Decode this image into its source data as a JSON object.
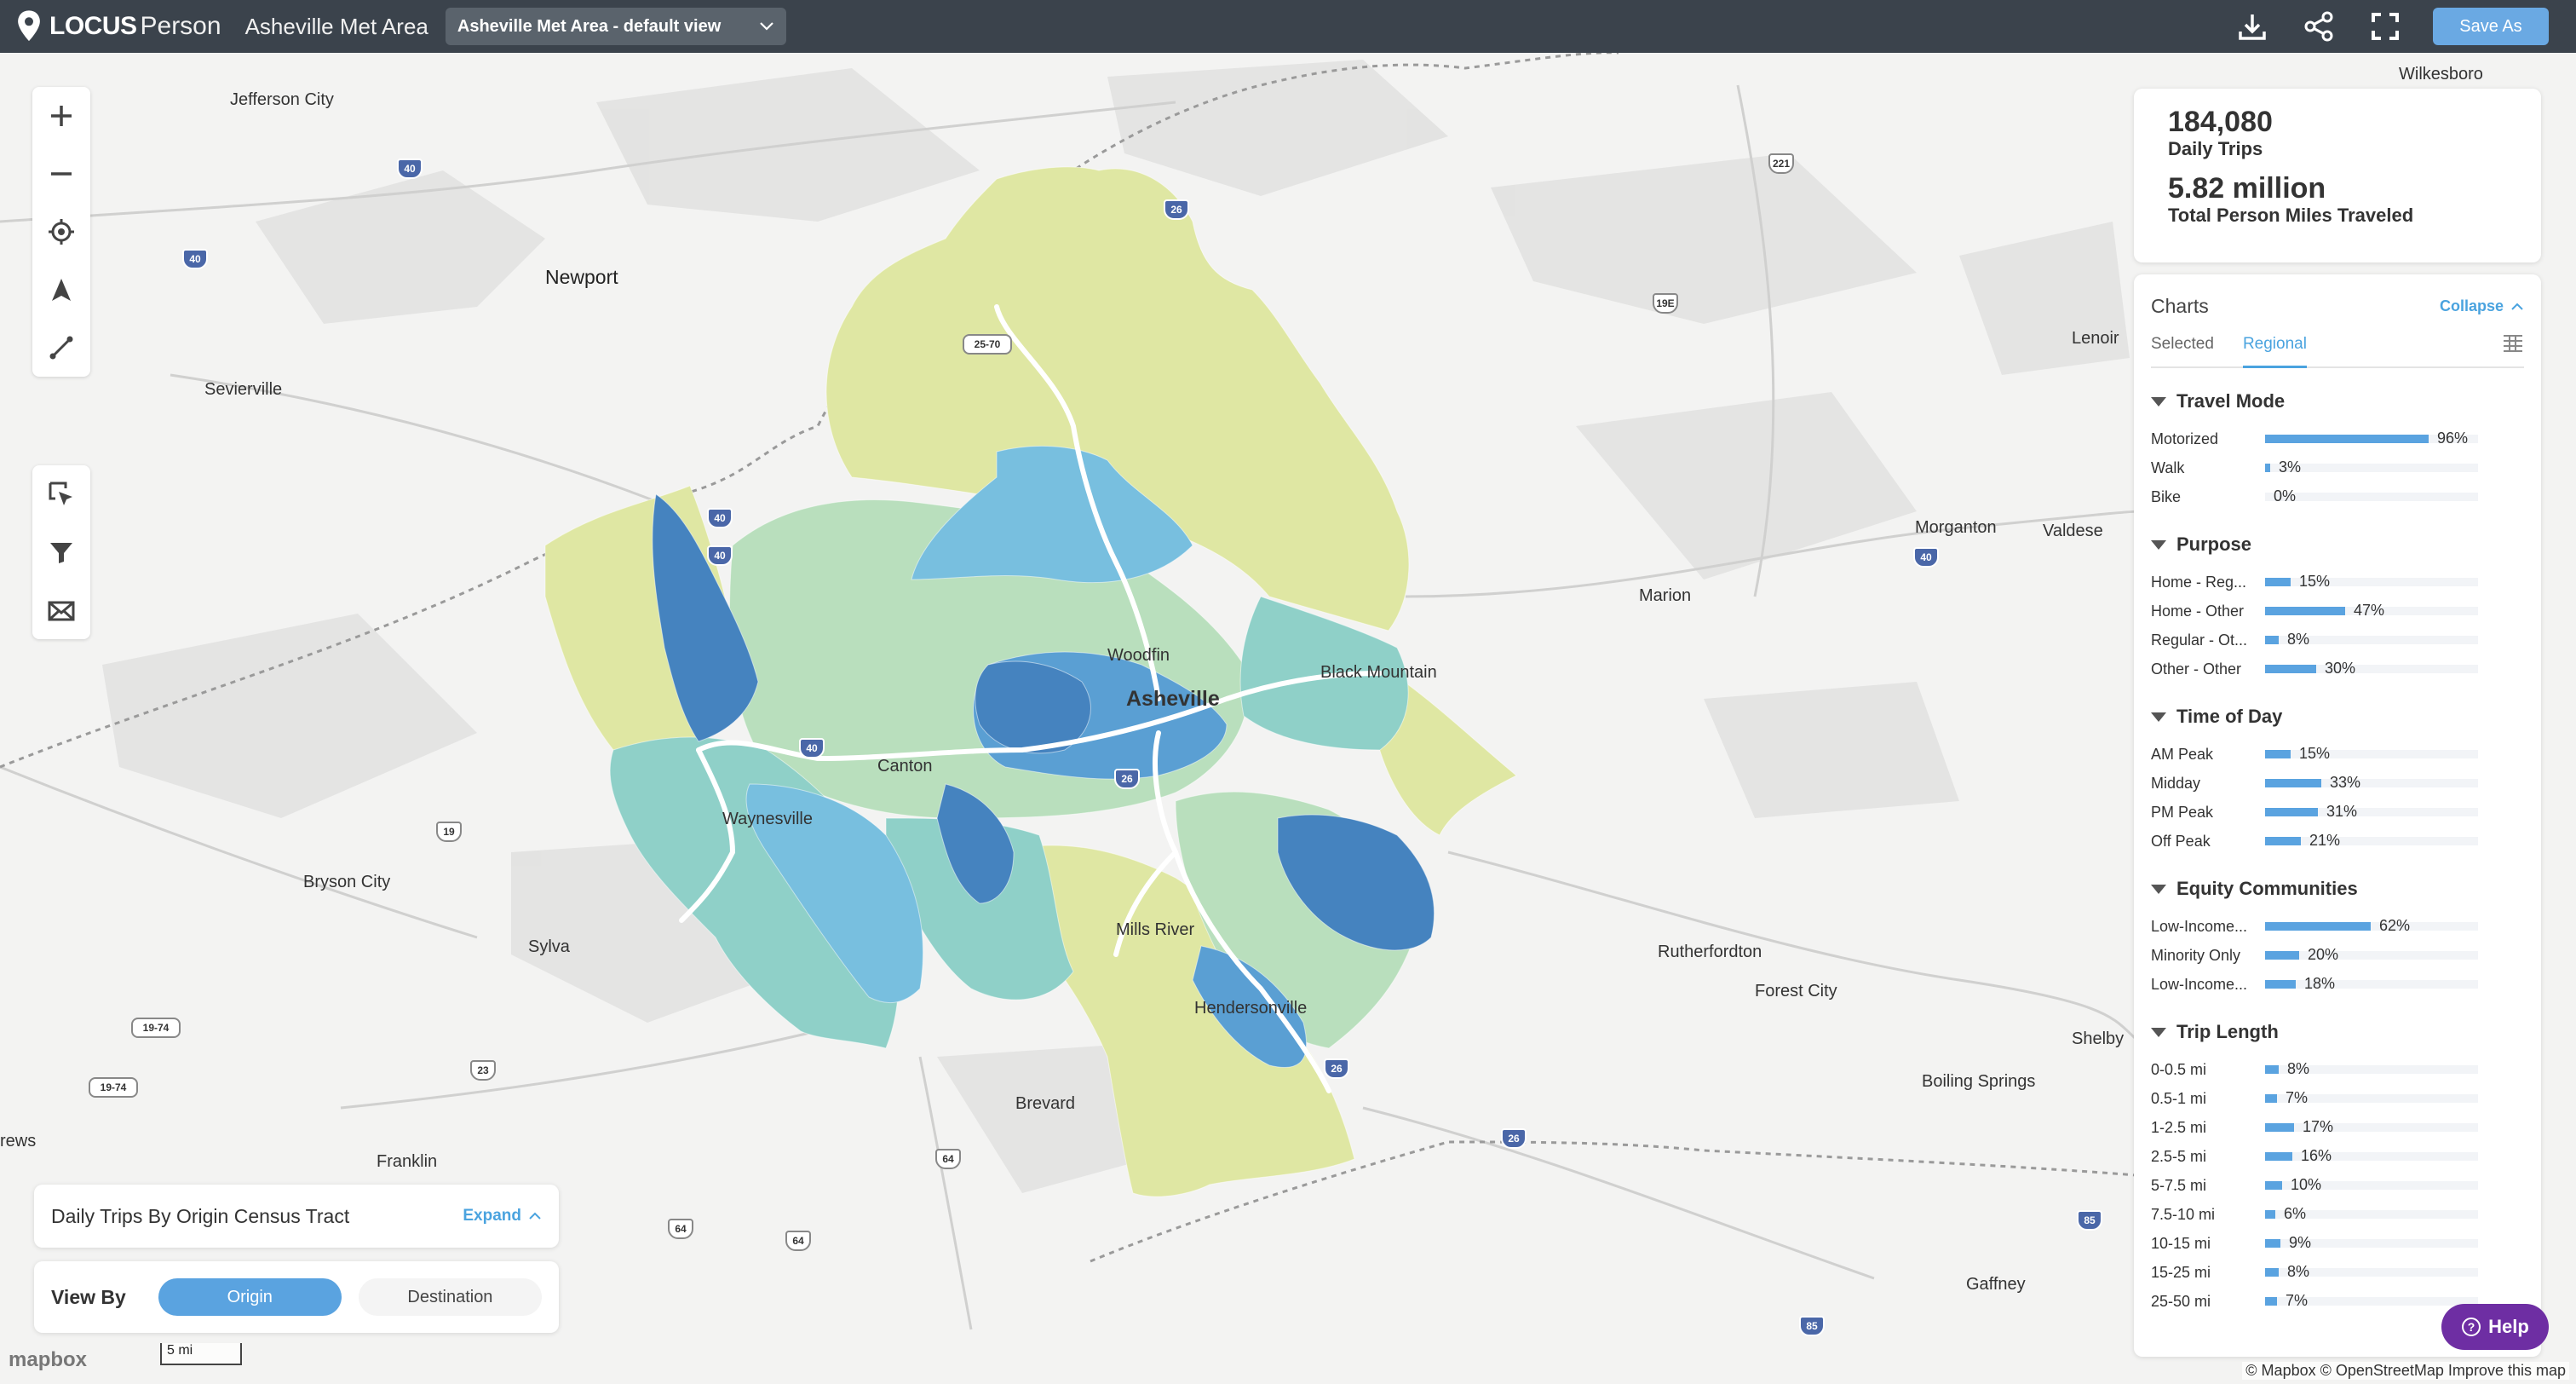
{
  "topbar": {
    "brand_bold": "LOCUS",
    "brand_product": "Person",
    "area_name": "Asheville Met Area",
    "view_select": "Asheville Met Area - default view",
    "save_label": "Save As",
    "icons": [
      "download-icon",
      "share-icon",
      "fullscreen-icon"
    ]
  },
  "stats": {
    "trips_value": "184,080",
    "trips_label": "Daily Trips",
    "miles_value": "5.82 million",
    "miles_label": "Total Person Miles Traveled"
  },
  "charts": {
    "title": "Charts",
    "collapse_label": "Collapse",
    "tabs": [
      "Selected",
      "Regional"
    ],
    "active_tab": "Regional",
    "sections": [
      {
        "title": "Travel Mode",
        "rows": [
          {
            "label": "Motorized",
            "pct": 96,
            "text": "96%"
          },
          {
            "label": "Walk",
            "pct": 3,
            "text": "3%"
          },
          {
            "label": "Bike",
            "pct": 0,
            "text": "0%"
          }
        ]
      },
      {
        "title": "Purpose",
        "rows": [
          {
            "label": "Home - Reg...",
            "pct": 15,
            "text": "15%"
          },
          {
            "label": "Home - Other",
            "pct": 47,
            "text": "47%"
          },
          {
            "label": "Regular - Ot...",
            "pct": 8,
            "text": "8%"
          },
          {
            "label": "Other - Other",
            "pct": 30,
            "text": "30%"
          }
        ]
      },
      {
        "title": "Time of Day",
        "rows": [
          {
            "label": "AM Peak",
            "pct": 15,
            "text": "15%"
          },
          {
            "label": "Midday",
            "pct": 33,
            "text": "33%"
          },
          {
            "label": "PM Peak",
            "pct": 31,
            "text": "31%"
          },
          {
            "label": "Off Peak",
            "pct": 21,
            "text": "21%"
          }
        ]
      },
      {
        "title": "Equity Communities",
        "rows": [
          {
            "label": "Low-Income...",
            "pct": 62,
            "text": "62%"
          },
          {
            "label": "Minority Only",
            "pct": 20,
            "text": "20%"
          },
          {
            "label": "Low-Income...",
            "pct": 18,
            "text": "18%"
          }
        ]
      },
      {
        "title": "Trip Length",
        "rows": [
          {
            "label": "0-0.5 mi",
            "pct": 8,
            "text": "8%"
          },
          {
            "label": "0.5-1 mi",
            "pct": 7,
            "text": "7%"
          },
          {
            "label": "1-2.5 mi",
            "pct": 17,
            "text": "17%"
          },
          {
            "label": "2.5-5 mi",
            "pct": 16,
            "text": "16%"
          },
          {
            "label": "5-7.5 mi",
            "pct": 10,
            "text": "10%"
          },
          {
            "label": "7.5-10 mi",
            "pct": 6,
            "text": "6%"
          },
          {
            "label": "10-15 mi",
            "pct": 9,
            "text": "9%"
          },
          {
            "label": "15-25 mi",
            "pct": 8,
            "text": "8%"
          },
          {
            "label": "25-50 mi",
            "pct": 7,
            "text": "7%"
          }
        ]
      }
    ]
  },
  "legend": {
    "title": "Daily Trips By Origin Census Tract",
    "expand_label": "Expand"
  },
  "view_by": {
    "title": "View By",
    "origin_label": "Origin",
    "destination_label": "Destination",
    "selected": "Origin"
  },
  "map": {
    "cities": [
      {
        "name": "Jefferson City",
        "cls": ""
      },
      {
        "name": "Newport",
        "cls": "big"
      },
      {
        "name": "Sevierville",
        "cls": ""
      },
      {
        "name": "Bryson City",
        "cls": ""
      },
      {
        "name": "Sylva",
        "cls": ""
      },
      {
        "name": "Franklin",
        "cls": ""
      },
      {
        "name": "Brevard",
        "cls": ""
      },
      {
        "name": "Canton",
        "cls": ""
      },
      {
        "name": "Waynesville",
        "cls": ""
      },
      {
        "name": "Woodfin",
        "cls": ""
      },
      {
        "name": "Asheville",
        "cls": "hub"
      },
      {
        "name": "Black Mountain",
        "cls": ""
      },
      {
        "name": "Mills River",
        "cls": ""
      },
      {
        "name": "Hendersonville",
        "cls": ""
      },
      {
        "name": "Marion",
        "cls": ""
      },
      {
        "name": "Morganton",
        "cls": ""
      },
      {
        "name": "Valdese",
        "cls": ""
      },
      {
        "name": "Lenoir",
        "cls": ""
      },
      {
        "name": "Wilkesboro",
        "cls": ""
      },
      {
        "name": "Rutherfordton",
        "cls": ""
      },
      {
        "name": "Forest City",
        "cls": ""
      },
      {
        "name": "Shelby",
        "cls": ""
      },
      {
        "name": "Boiling Springs",
        "cls": ""
      },
      {
        "name": "Gaffney",
        "cls": ""
      },
      {
        "name": "rews",
        "cls": ""
      }
    ],
    "shields": [
      {
        "num": "40",
        "cls": "i"
      },
      {
        "num": "40",
        "cls": "i"
      },
      {
        "num": "26",
        "cls": "i"
      },
      {
        "num": "25-70",
        "cls": "wide"
      },
      {
        "num": "40",
        "cls": "i"
      },
      {
        "num": "40",
        "cls": "i"
      },
      {
        "num": "40",
        "cls": "i"
      },
      {
        "num": "26",
        "cls": "i"
      },
      {
        "num": "19",
        "cls": ""
      },
      {
        "num": "19-74",
        "cls": "wide"
      },
      {
        "num": "19-74",
        "cls": "wide"
      },
      {
        "num": "23",
        "cls": ""
      },
      {
        "num": "64",
        "cls": ""
      },
      {
        "num": "64",
        "cls": ""
      },
      {
        "num": "64",
        "cls": ""
      },
      {
        "num": "26",
        "cls": "i"
      },
      {
        "num": "26",
        "cls": "i"
      },
      {
        "num": "221",
        "cls": ""
      },
      {
        "num": "19E",
        "cls": ""
      },
      {
        "num": "40",
        "cls": "i"
      },
      {
        "num": "85",
        "cls": "i"
      },
      {
        "num": "85",
        "cls": "i"
      }
    ],
    "colors": {
      "yellow": "#dfe7a3",
      "pale_green": "#b9dfbd",
      "teal": "#8fd0c8",
      "light_blue": "#78bfdf",
      "mid_blue": "#5a9fd3",
      "dark_blue": "#4583bf"
    },
    "scale_label": "5 mi",
    "mapbox_label": "mapbox",
    "attribution": "© Mapbox © OpenStreetMap  Improve this map",
    "help_label": "Help"
  }
}
